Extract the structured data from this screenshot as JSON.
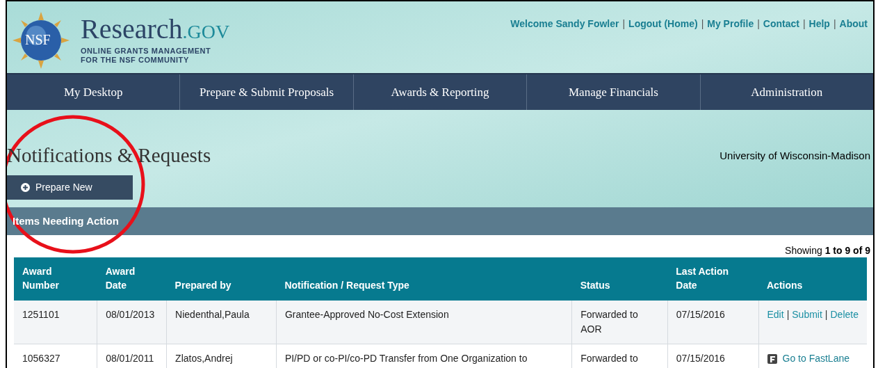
{
  "header": {
    "logo_badge": "NSF",
    "logo_name": "Research",
    "logo_suffix": ".GOV",
    "tagline_1": "ONLINE GRANTS MANAGEMENT",
    "tagline_2": "FOR THE NSF COMMUNITY",
    "welcome": "Welcome Sandy Fowler",
    "user_links": [
      {
        "label": "Logout (Home)"
      },
      {
        "label": "My Profile"
      },
      {
        "label": "Contact"
      },
      {
        "label": "Help"
      },
      {
        "label": "About"
      }
    ],
    "separator": "|"
  },
  "nav": [
    {
      "label": "My Desktop"
    },
    {
      "label": "Prepare & Submit Proposals"
    },
    {
      "label": "Awards & Reporting"
    },
    {
      "label": "Manage Financials"
    },
    {
      "label": "Administration"
    }
  ],
  "page_title": "Notifications & Requests",
  "organization": "University of Wisconsin-Madison",
  "prepare_button": "Prepare New",
  "annotation": {
    "kind": "circle"
  },
  "section_title": "Items Needing Action",
  "showing": "Showing **1 to 9 of 9**",
  "table": {
    "columns": [
      "Award Number",
      "Award Date",
      "Prepared by",
      "Notification / Request Type",
      "Status",
      "Last Action Date",
      "Actions"
    ],
    "separator": "|",
    "rows": [
      {
        "cells": [
          "1251101",
          "08/01/2013",
          "Niedenthal,Paula",
          "Grantee-Approved No-Cost Extension",
          "Forwarded to AOR",
          "07/15/2016"
        ],
        "actions": [
          {
            "label": "Edit",
            "kind": "link"
          },
          {
            "label": "Submit",
            "kind": "link"
          },
          {
            "label": "Delete",
            "kind": "link"
          }
        ]
      },
      {
        "cells": [
          "1056327",
          "08/01/2011",
          "Zlatos,Andrej",
          "PI/PD or co-PI/co-PD Transfer from One Organization to",
          "Forwarded to",
          "07/15/2016"
        ],
        "actions": [
          {
            "label": "Go to FastLane",
            "kind": "fastlane"
          }
        ]
      }
    ]
  }
}
